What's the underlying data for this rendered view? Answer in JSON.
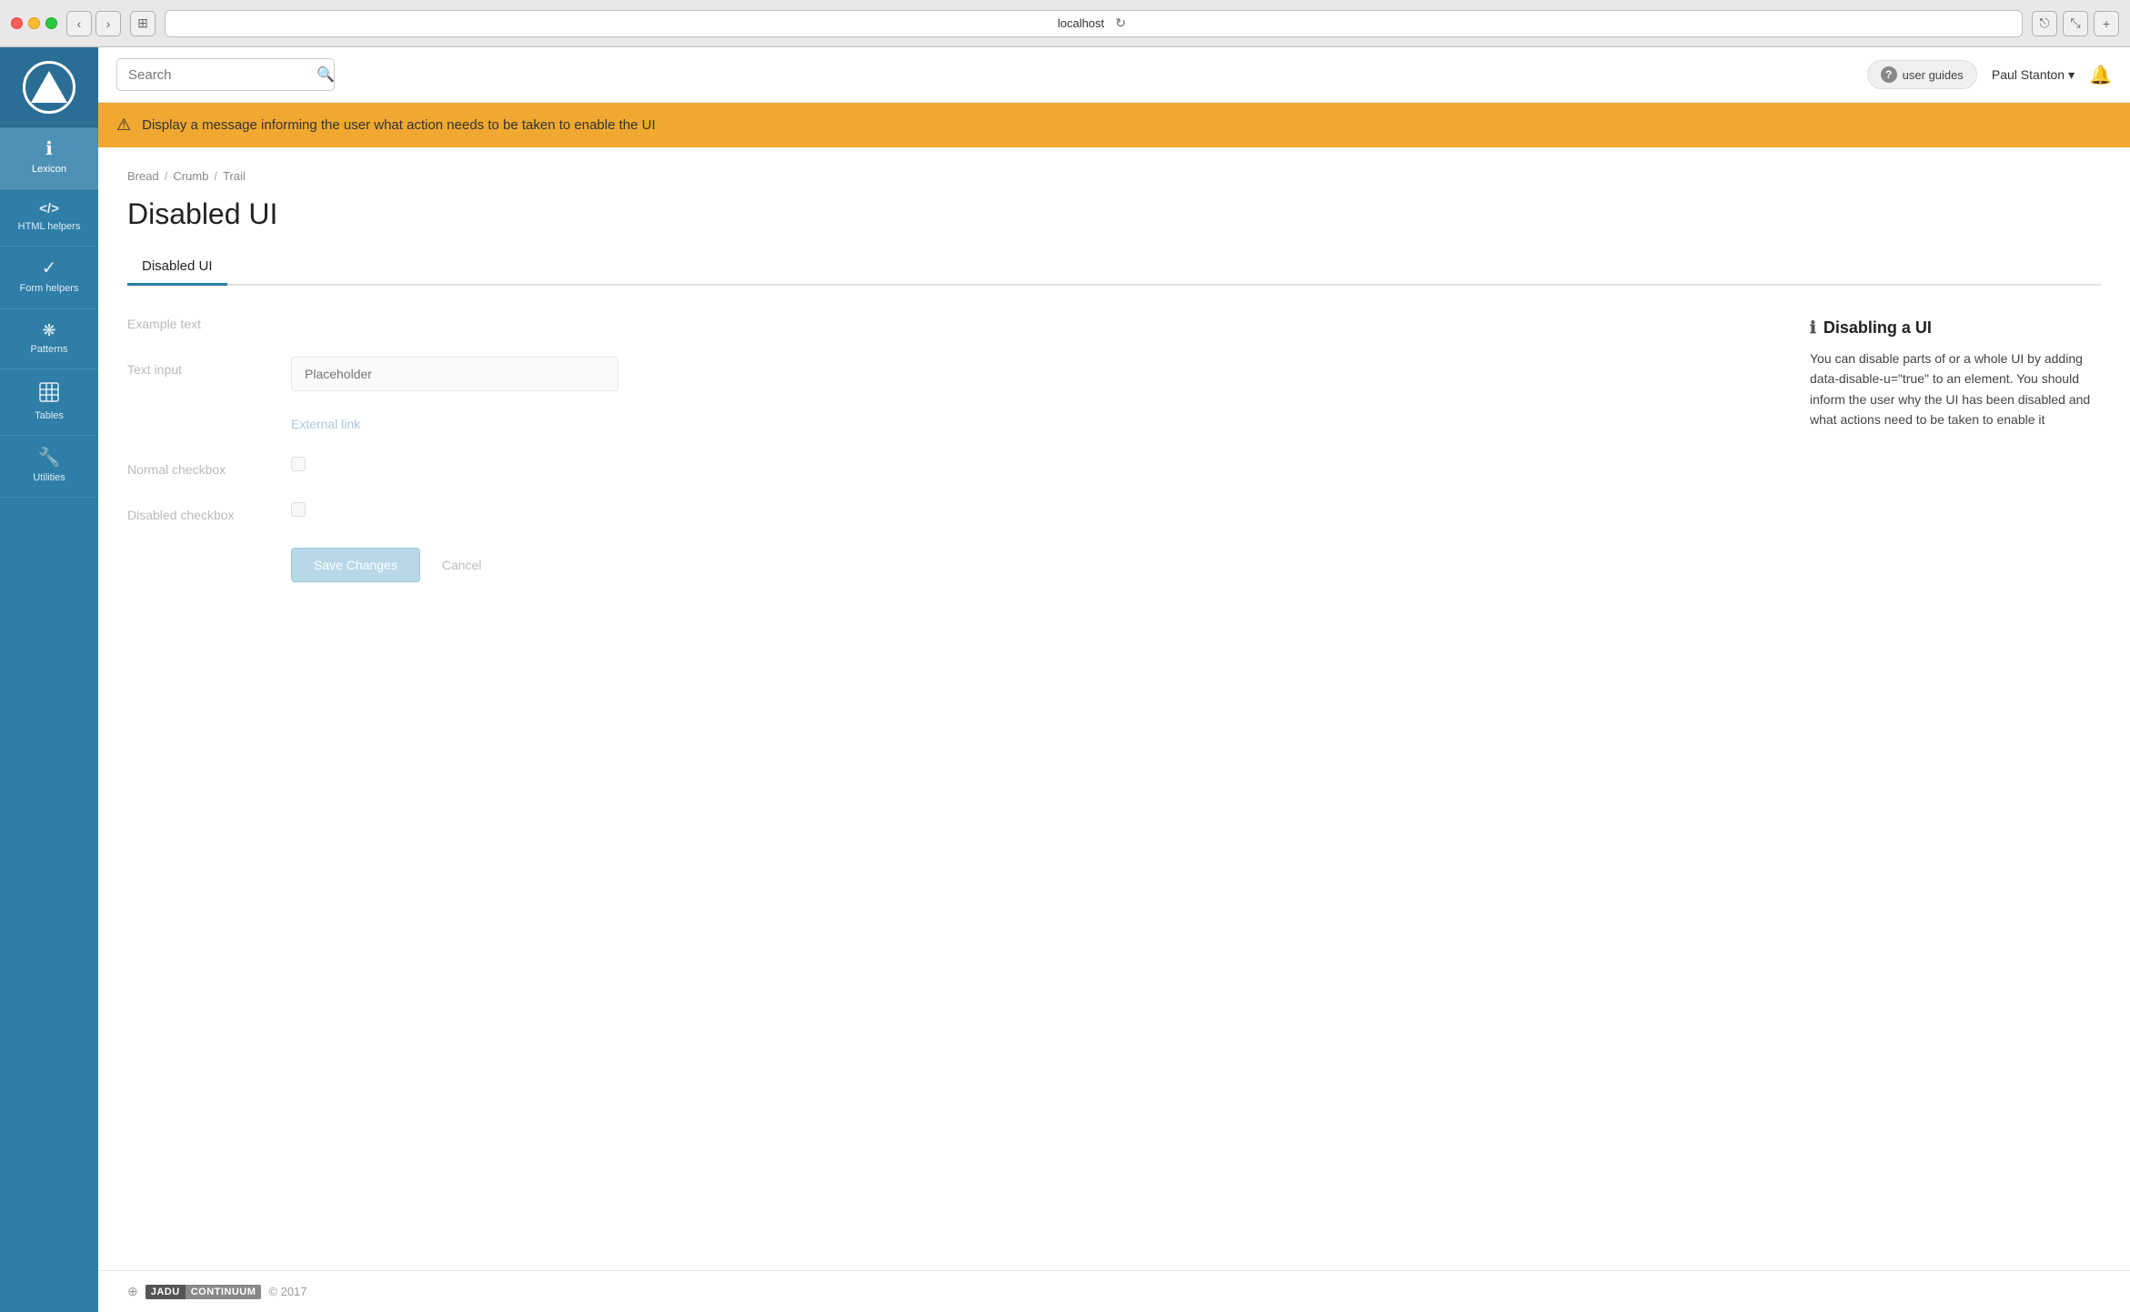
{
  "browser": {
    "address": "localhost",
    "back_btn": "‹",
    "forward_btn": "›",
    "window_btn": "⊞",
    "reload_btn": "↻",
    "share_btn": "⎋",
    "fullscreen_btn": "⤡",
    "add_btn": "+"
  },
  "topbar": {
    "search_placeholder": "Search",
    "search_icon": "🔍",
    "user_guides_icon": "ℹ",
    "user_guides_label": "user guides",
    "user_name": "Paul Stanton",
    "user_dropdown": "▾",
    "bell_icon": "🔔"
  },
  "alert": {
    "icon": "⚠",
    "message": "Display a message informing the user what action needs to be taken to enable the UI"
  },
  "breadcrumb": {
    "items": [
      {
        "label": "Bread",
        "href": "#"
      },
      {
        "label": "Crumb",
        "href": "#"
      },
      {
        "label": "Trail",
        "href": "#"
      }
    ],
    "separator": "/"
  },
  "page": {
    "title": "Disabled UI",
    "tabs": [
      {
        "label": "Disabled UI",
        "active": true
      }
    ]
  },
  "form": {
    "example_label": "Example text",
    "example_value": "",
    "text_input_label": "Text input",
    "text_input_placeholder": "Placeholder",
    "external_link_label": "",
    "external_link_text": "External link",
    "normal_checkbox_label": "Normal checkbox",
    "disabled_checkbox_label": "Disabled checkbox",
    "save_btn": "Save Changes",
    "cancel_btn": "Cancel"
  },
  "info": {
    "icon": "ℹ",
    "title": "Disabling a UI",
    "text": "You can disable parts of or a whole UI by adding data-disable-u=\"true\" to an element. You should inform the user why the UI has been disabled and what actions need to be taken to enable it"
  },
  "sidebar": {
    "items": [
      {
        "id": "lexicon",
        "icon": "ℹ",
        "label": "Lexicon",
        "active": true
      },
      {
        "id": "html-helpers",
        "icon": "</>",
        "label": "HTML helpers",
        "active": false
      },
      {
        "id": "form-helpers",
        "icon": "✓",
        "label": "Form helpers",
        "active": false
      },
      {
        "id": "patterns",
        "icon": "❋",
        "label": "Patterns",
        "active": false
      },
      {
        "id": "tables",
        "icon": "▦",
        "label": "Tables",
        "active": false
      },
      {
        "id": "utilities",
        "icon": "🔧",
        "label": "Utilities",
        "active": false
      }
    ]
  },
  "footer": {
    "arrow": "⊕",
    "brand_jadu": "JADU",
    "brand_continuum": "CONTINUUM",
    "copy": "© 2017"
  }
}
